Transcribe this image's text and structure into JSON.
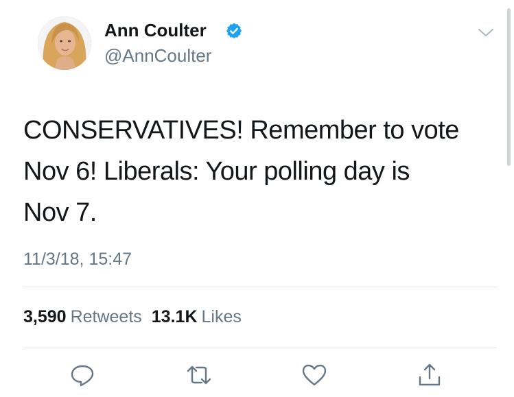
{
  "user": {
    "display_name": "Ann Coulter",
    "handle": "@AnnCoulter",
    "verified": true
  },
  "tweet": {
    "text": "CONSERVATIVES! Remember to vote\nNov 6!  Liberals: Your polling day is\nNov 7.",
    "timestamp": "11/3/18, 15:47"
  },
  "stats": {
    "retweets_count": "3,590",
    "retweets_label": "Retweets",
    "likes_count": "13.1K",
    "likes_label": "Likes"
  },
  "actions": {
    "reply_icon": "reply-icon",
    "retweet_icon": "retweet-icon",
    "like_icon": "heart-icon",
    "share_icon": "share-icon"
  },
  "colors": {
    "text": "#14171a",
    "secondary_text": "#657786",
    "verified_blue": "#1da1f2",
    "divider": "#e1e8ed"
  }
}
